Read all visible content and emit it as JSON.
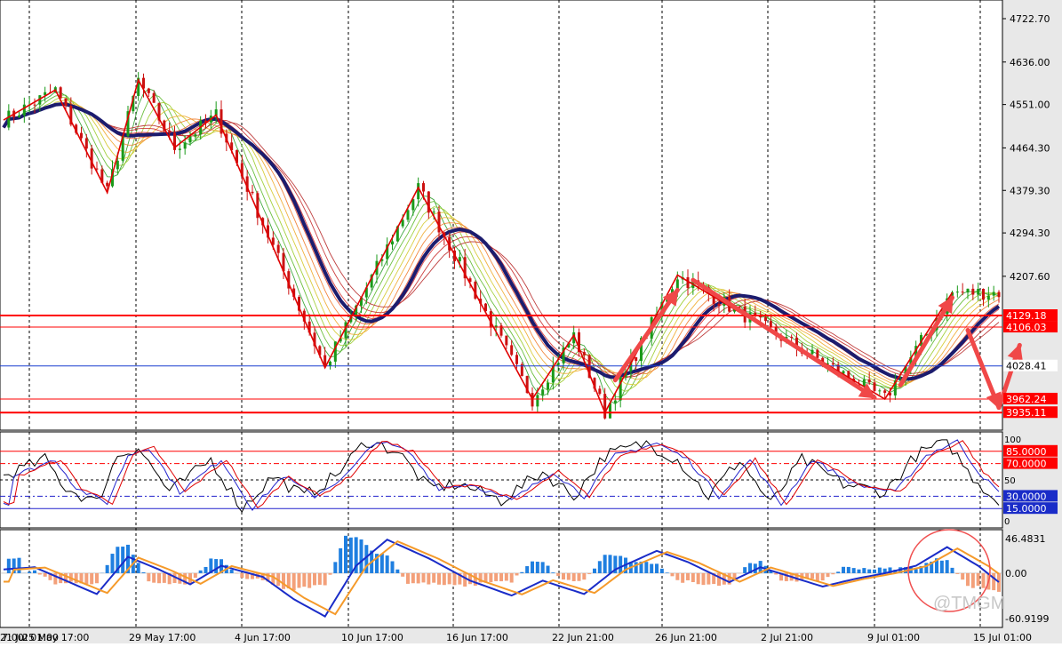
{
  "colors": {
    "background": "#e8e8e8",
    "plot_bg": "#ffffff",
    "grid": "#000000",
    "level_line": "#ff0000",
    "price_line": "#1a3fd0",
    "ma_thick": "#1c1c6e",
    "zigzag": "#e00000",
    "arrow": "#f04848",
    "bull_candle": "#1a9a1a",
    "bear_candle": "#cc1111",
    "macd_pos": "#1f7fe0",
    "macd_neg": "#f3a07a",
    "macd_blue": "#1a2cc8",
    "macd_orange": "#f59a2a",
    "stoch_black": "#000000",
    "stoch_red": "#e00000",
    "stoch_blue": "#2222cc",
    "circle": "#f05050"
  },
  "watermark": "@TMGM",
  "chart_data": [
    {
      "type": "candlestick",
      "panel": "price",
      "title": "",
      "ylim": [
        3900,
        4760
      ],
      "y_ticks": [
        "4722.70",
        "4636.00",
        "4551.00",
        "4464.30",
        "4379.30",
        "4294.30",
        "4207.60"
      ],
      "x_ticks": [
        "7:00",
        "25 May 17:00",
        "29 May 17:00",
        "4 Jun 17:00",
        "10 Jun 17:00",
        "16 Jun 17:00",
        "22 Jun 21:00",
        "26 Jun 21:00",
        "2 Jul 21:00",
        "9 Jul 01:00",
        "15 Jul 01:00",
        "21 Jul 01:00"
      ],
      "levels": [
        {
          "label": "4129.18",
          "value": 4129.18,
          "style": "red"
        },
        {
          "label": "4106.03",
          "value": 4106.03,
          "style": "red"
        },
        {
          "label": "4028.41",
          "value": 4028.41,
          "style": "current"
        },
        {
          "label": "3962.24",
          "value": 3962.24,
          "style": "red"
        },
        {
          "label": "3935.11",
          "value": 3935.11,
          "style": "red"
        }
      ],
      "zigzag": [
        {
          "i": 0,
          "v": 4520
        },
        {
          "i": 10,
          "v": 4580
        },
        {
          "i": 20,
          "v": 4375
        },
        {
          "i": 26,
          "v": 4600
        },
        {
          "i": 33,
          "v": 4465
        },
        {
          "i": 41,
          "v": 4530
        },
        {
          "i": 62,
          "v": 4025
        },
        {
          "i": 80,
          "v": 4385
        },
        {
          "i": 102,
          "v": 3962
        },
        {
          "i": 110,
          "v": 4090
        },
        {
          "i": 116,
          "v": 3935
        },
        {
          "i": 130,
          "v": 4210
        },
        {
          "i": 170,
          "v": 3962
        },
        {
          "i": 183,
          "v": 4175
        }
      ],
      "arrows": [
        {
          "from": {
            "i": 118,
            "v": 4000
          },
          "to": {
            "i": 130,
            "v": 4180
          }
        },
        {
          "from": {
            "i": 133,
            "v": 4200
          },
          "to": {
            "i": 168,
            "v": 3965
          }
        },
        {
          "from": {
            "i": 173,
            "v": 3990
          },
          "to": {
            "i": 183,
            "v": 4165
          }
        },
        {
          "from": {
            "i": 186,
            "v": 4100
          },
          "to": {
            "i": 192,
            "v": 3945
          }
        },
        {
          "from": {
            "i": 192,
            "v": 3945
          },
          "to": {
            "i": 196,
            "v": 4070
          }
        }
      ],
      "n_bars": 192
    },
    {
      "type": "line",
      "panel": "stochastic",
      "ylim": [
        0,
        100
      ],
      "y_ticks": [
        "100",
        "50",
        "0"
      ],
      "levels": [
        {
          "label": "85.0000",
          "value": 85
        },
        {
          "label": "70.0000",
          "value": 70
        },
        {
          "label": "30.0000",
          "value": 30
        },
        {
          "label": "15.0000",
          "value": 15
        }
      ],
      "series_shape": [
        {
          "i": 0,
          "v": 55
        },
        {
          "i": 8,
          "v": 75
        },
        {
          "i": 12,
          "v": 40
        },
        {
          "i": 18,
          "v": 22
        },
        {
          "i": 22,
          "v": 80
        },
        {
          "i": 26,
          "v": 90
        },
        {
          "i": 32,
          "v": 35
        },
        {
          "i": 40,
          "v": 75
        },
        {
          "i": 46,
          "v": 15
        },
        {
          "i": 52,
          "v": 55
        },
        {
          "i": 58,
          "v": 30
        },
        {
          "i": 64,
          "v": 55
        },
        {
          "i": 70,
          "v": 98
        },
        {
          "i": 76,
          "v": 85
        },
        {
          "i": 82,
          "v": 40
        },
        {
          "i": 88,
          "v": 45
        },
        {
          "i": 96,
          "v": 25
        },
        {
          "i": 104,
          "v": 60
        },
        {
          "i": 110,
          "v": 30
        },
        {
          "i": 116,
          "v": 80
        },
        {
          "i": 124,
          "v": 95
        },
        {
          "i": 130,
          "v": 75
        },
        {
          "i": 136,
          "v": 30
        },
        {
          "i": 142,
          "v": 75
        },
        {
          "i": 148,
          "v": 20
        },
        {
          "i": 154,
          "v": 75
        },
        {
          "i": 162,
          "v": 45
        },
        {
          "i": 170,
          "v": 35
        },
        {
          "i": 176,
          "v": 80
        },
        {
          "i": 182,
          "v": 98
        },
        {
          "i": 186,
          "v": 60
        },
        {
          "i": 192,
          "v": 22
        }
      ]
    },
    {
      "type": "bar+line",
      "panel": "macd",
      "ylim": [
        -60.9199,
        46.4831
      ],
      "y_ticks": [
        "46.4831",
        "0.00",
        "-60.9199"
      ],
      "series_shape": [
        {
          "i": 0,
          "v": 5
        },
        {
          "i": 6,
          "v": 8
        },
        {
          "i": 12,
          "v": -10
        },
        {
          "i": 18,
          "v": -28
        },
        {
          "i": 24,
          "v": 22
        },
        {
          "i": 30,
          "v": 5
        },
        {
          "i": 36,
          "v": -15
        },
        {
          "i": 42,
          "v": 10
        },
        {
          "i": 50,
          "v": -5
        },
        {
          "i": 56,
          "v": -35
        },
        {
          "i": 62,
          "v": -58
        },
        {
          "i": 68,
          "v": 10
        },
        {
          "i": 74,
          "v": 45
        },
        {
          "i": 82,
          "v": 20
        },
        {
          "i": 90,
          "v": -10
        },
        {
          "i": 98,
          "v": -30
        },
        {
          "i": 104,
          "v": -10
        },
        {
          "i": 112,
          "v": -28
        },
        {
          "i": 118,
          "v": 5
        },
        {
          "i": 126,
          "v": 30
        },
        {
          "i": 132,
          "v": 15
        },
        {
          "i": 140,
          "v": -12
        },
        {
          "i": 146,
          "v": 8
        },
        {
          "i": 152,
          "v": -5
        },
        {
          "i": 158,
          "v": -18
        },
        {
          "i": 164,
          "v": -8
        },
        {
          "i": 170,
          "v": 0
        },
        {
          "i": 176,
          "v": 10
        },
        {
          "i": 182,
          "v": 35
        },
        {
          "i": 188,
          "v": 10
        },
        {
          "i": 192,
          "v": -12
        }
      ]
    }
  ]
}
